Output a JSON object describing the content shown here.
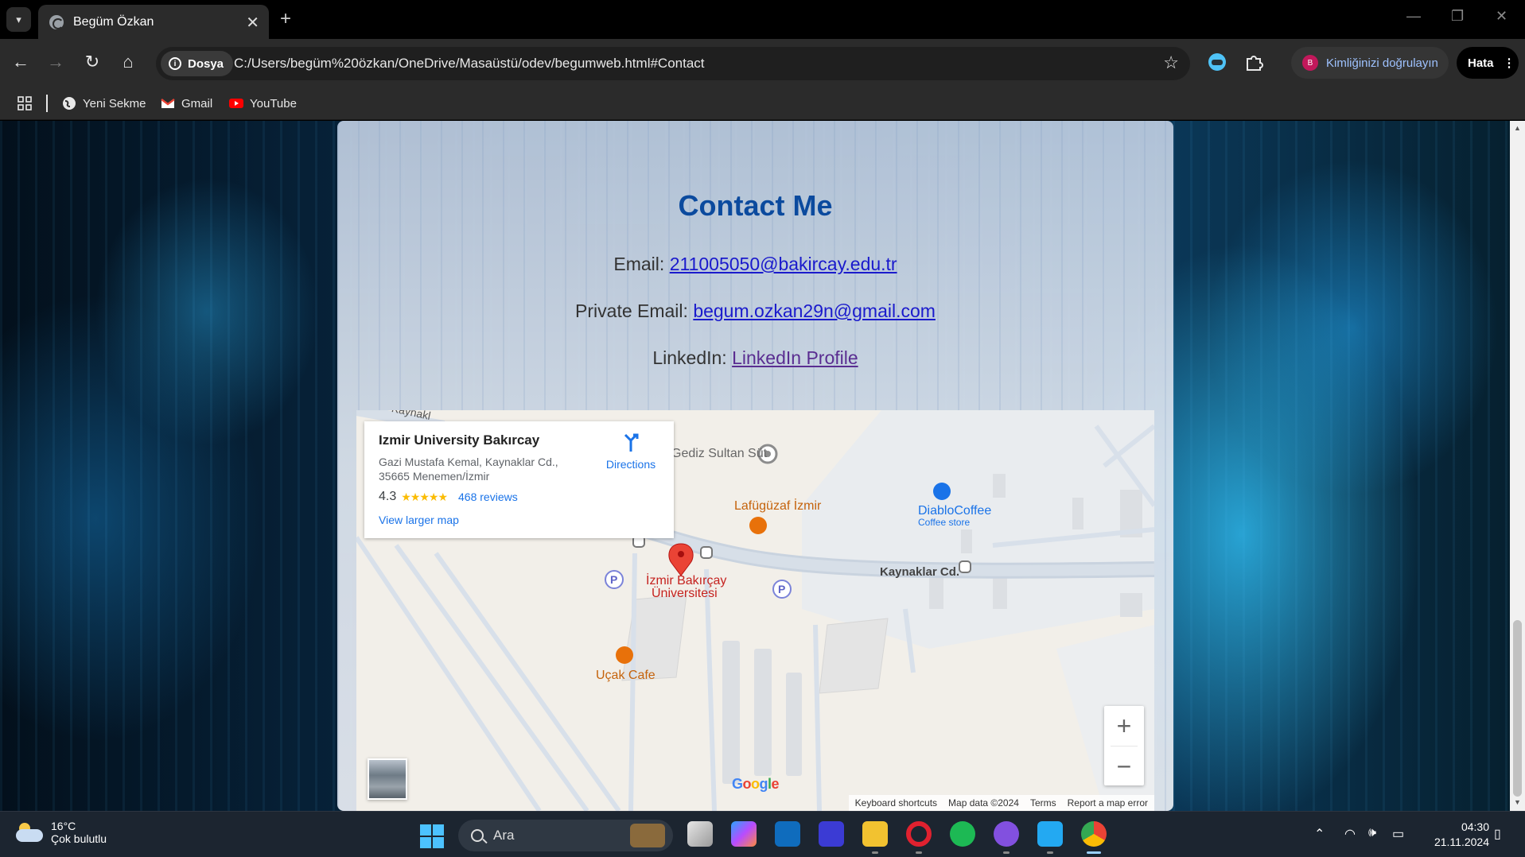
{
  "browser": {
    "tab_title": "Begüm Özkan",
    "security_label": "Dosya",
    "url": "C:/Users/begüm%20özkan/OneDrive/Masaüstü/odev/begumweb.html#Contact",
    "profile_label": "Kimliğinizi doğrulayın",
    "profile_initial": "B",
    "error_button": "Hata",
    "bookmarks": [
      {
        "label": "Yeni Sekme",
        "icon": "globe-icon"
      },
      {
        "label": "Gmail",
        "icon": "gmail-icon"
      },
      {
        "label": "YouTube",
        "icon": "youtube-icon"
      }
    ]
  },
  "contact": {
    "title": "Contact Me",
    "email_label": "Email: ",
    "email": "211005050@bakircay.edu.tr",
    "private_email_label": "Private Email: ",
    "private_email": "begum.ozkan29n@gmail.com",
    "linkedin_label": "LinkedIn: ",
    "linkedin_text": "LinkedIn Profile"
  },
  "map": {
    "place_name": "Izmir University Bakırcay",
    "address": "Gazi Mustafa Kemal, Kaynaklar Cd., 35665 Menemen/İzmir",
    "rating": "4.3",
    "stars": "★★★★★",
    "reviews": "468 reviews",
    "view_larger": "View larger map",
    "directions": "Directions",
    "labels": {
      "gediz": "Gediz Sultan Süt",
      "lafuguzaf": "Lafügüzaf İzmir",
      "diablo": "DiabloCoffee",
      "diablo_sub": "Coffee store",
      "kaynaklar": "Kaynaklar Cd.",
      "kaynaklar_top": "Kaynakl",
      "univ_1": "İzmir Bakırçay",
      "univ_2": "Üniversitesi",
      "ucak": "Uçak Cafe",
      "parking": "P"
    },
    "google": "Google",
    "footer": [
      "Keyboard shortcuts",
      "Map data ©2024",
      "Terms",
      "Report a map error"
    ]
  },
  "taskbar": {
    "temperature": "16°C",
    "weather": "Çok bulutlu",
    "search_placeholder": "Ara",
    "time": "04:30",
    "date": "21.11.2024"
  },
  "colors": {
    "title_blue": "#0b4a9e",
    "link_blue": "#1a1acc",
    "link_visited": "#5a2d91",
    "map_orange": "#e8710a",
    "map_pin_red": "#ea4335",
    "map_blue_link": "#1a73e8"
  }
}
